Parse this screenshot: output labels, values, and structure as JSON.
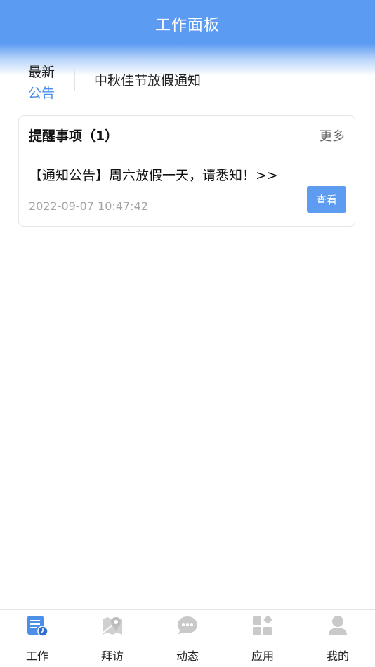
{
  "header": {
    "title": "工作面板"
  },
  "notice": {
    "tag_line1": "最新",
    "tag_line2": "公告",
    "text": "中秋佳节放假通知"
  },
  "reminders": {
    "title": "提醒事项（1）",
    "more_label": "更多",
    "items": [
      {
        "text": "【通知公告】周六放假一天，请悉知！>>",
        "time": "2022-09-07 10:47:42",
        "button_label": "查看"
      }
    ]
  },
  "tabbar": {
    "items": [
      {
        "label": "工作",
        "icon": "work-icon",
        "active": true
      },
      {
        "label": "拜访",
        "icon": "map-pin-icon"
      },
      {
        "label": "动态",
        "icon": "chat-bubble-icon"
      },
      {
        "label": "应用",
        "icon": "apps-grid-icon"
      },
      {
        "label": "我的",
        "icon": "user-icon"
      }
    ]
  },
  "colors": {
    "accent": "#5b9bf2",
    "icon_inactive": "#c9c9c9",
    "tag_blue": "#4a8fe8"
  }
}
